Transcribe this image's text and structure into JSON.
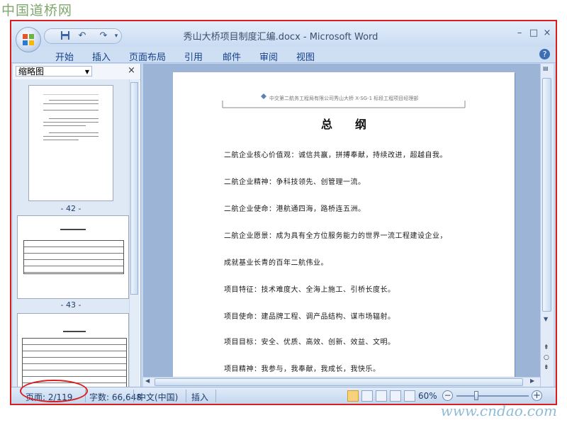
{
  "watermark_top": "中国道桥网",
  "watermark_bottom": "www.cndao.com",
  "window": {
    "title": "秀山大桥项目制度汇编.docx - Microsoft Word",
    "minimize": "–",
    "maximize": "□",
    "close": "×"
  },
  "quick_access": {
    "save": "💾",
    "undo": "↶",
    "redo": "↷",
    "customize": "▾"
  },
  "ribbon_tabs": [
    "开始",
    "插入",
    "页面布局",
    "引用",
    "邮件",
    "审阅",
    "视图"
  ],
  "help": "?",
  "thumbnail_pane": {
    "selector": "缩略图",
    "close": "×",
    "page_labels": [
      "- 42 -",
      "- 43 -"
    ]
  },
  "document": {
    "header_text": "中交第二航务工程局有限公司秀山大桥 X-SG-1 标段工程项目经理部",
    "title": "总　　纲",
    "lines": [
      "二航企业核心价值观：诚信共赢，拼搏奉献，持续改进，超越自我。",
      "二航企业精神：争科技领先、创管理一流。",
      "二航企业使命：港航通四海，路桥连五洲。",
      "二航企业愿景：成为具有全方位服务能力的世界一流工程建设企业，",
      "成就基业长青的百年二航伟业。",
      "项目特征：技术难度大、全海上施工、引桥长度长。",
      "项目使命：建品牌工程、调产品结构、谋市场辐射。",
      "项目目标：安全、优质、高效、创新、效益、文明。",
      "项目精神：我参与，我奉献，我成长，我快乐。"
    ]
  },
  "status_bar": {
    "page": "页面: 2/119",
    "word_count": "字数: 66,648",
    "language": "中文(中国)",
    "mode": "插入",
    "zoom": "60%",
    "zoom_level": 0.6
  },
  "colors": {
    "highlight": "#d81e1e",
    "ribbon_text": "#15428b"
  }
}
